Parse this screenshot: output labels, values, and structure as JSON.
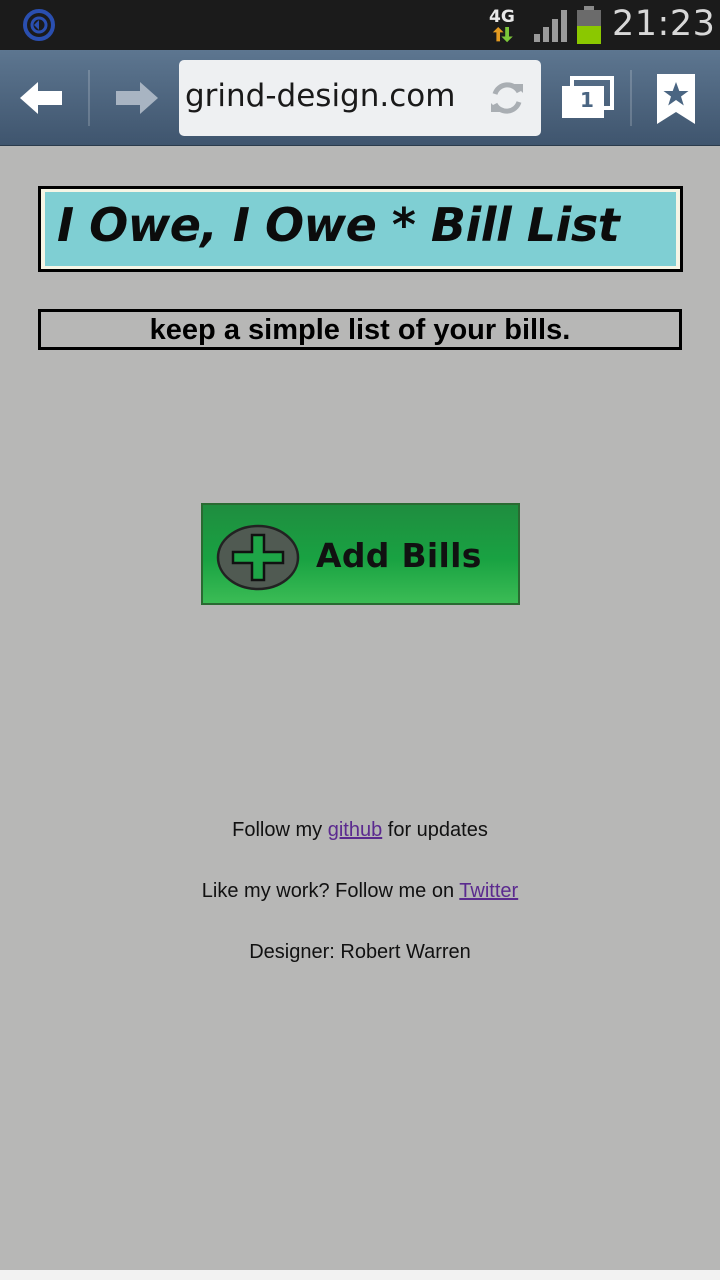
{
  "status_bar": {
    "network_type": "4G",
    "time": "21:23",
    "icons": [
      "sync-app-icon",
      "data-arrows-icon",
      "signal-icon",
      "battery-icon"
    ]
  },
  "browser": {
    "url": "grind-design.com",
    "tab_count": "1",
    "icons": [
      "back-arrow-icon",
      "forward-arrow-icon",
      "reload-icon",
      "tabs-icon",
      "bookmark-icon"
    ]
  },
  "page": {
    "banner_title": "I Owe, I Owe * Bill List",
    "tagline": "keep a simple list of your bills.",
    "add_button_label": "Add Bills",
    "footer": {
      "github_prefix": "Follow my",
      "github_link": "github",
      "github_suffix": "for updates",
      "twitter_prefix": "Like my work? Follow me on",
      "twitter_link": "Twitter",
      "designer": "Designer: Robert Warren"
    }
  },
  "colors": {
    "page_background": "#b7b7b6",
    "banner_fill": "#7fcfd3",
    "button_green": "#19a242",
    "link_purple": "#5b2a8f",
    "toolbar_blue": "#4f6781"
  }
}
